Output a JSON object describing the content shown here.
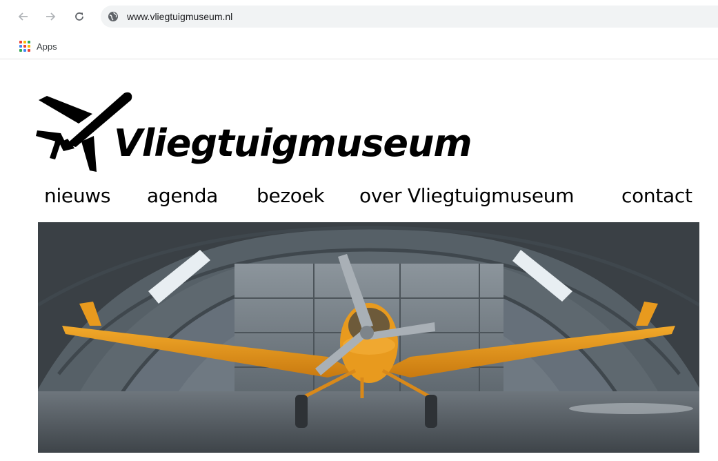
{
  "browser": {
    "url": "www.vliegtuigmuseum.nl",
    "bookmarks": [
      {
        "label": "Apps",
        "icon": "apps-grid-icon"
      }
    ],
    "icons": [
      "back-arrow-icon",
      "forward-arrow-icon",
      "reload-icon",
      "globe-icon"
    ]
  },
  "site": {
    "logo_text": "Vliegtuigmuseum",
    "logo_icon": "airplane-icon",
    "nav": [
      {
        "label": "nieuws"
      },
      {
        "label": "agenda"
      },
      {
        "label": "bezoek"
      },
      {
        "label": "over Vliegtuigmuseum"
      },
      {
        "label": "contact"
      }
    ],
    "hero": {
      "plane_color": "#e89a1e",
      "hangar_color": "#5d666e"
    }
  },
  "colors": {
    "omnibox_bg": "#f1f3f4",
    "apps_dots": [
      "#ea4335",
      "#fbbc05",
      "#34a853",
      "#4285f4",
      "#ea4335",
      "#fbbc05",
      "#34a853",
      "#4285f4",
      "#ea4335"
    ]
  }
}
